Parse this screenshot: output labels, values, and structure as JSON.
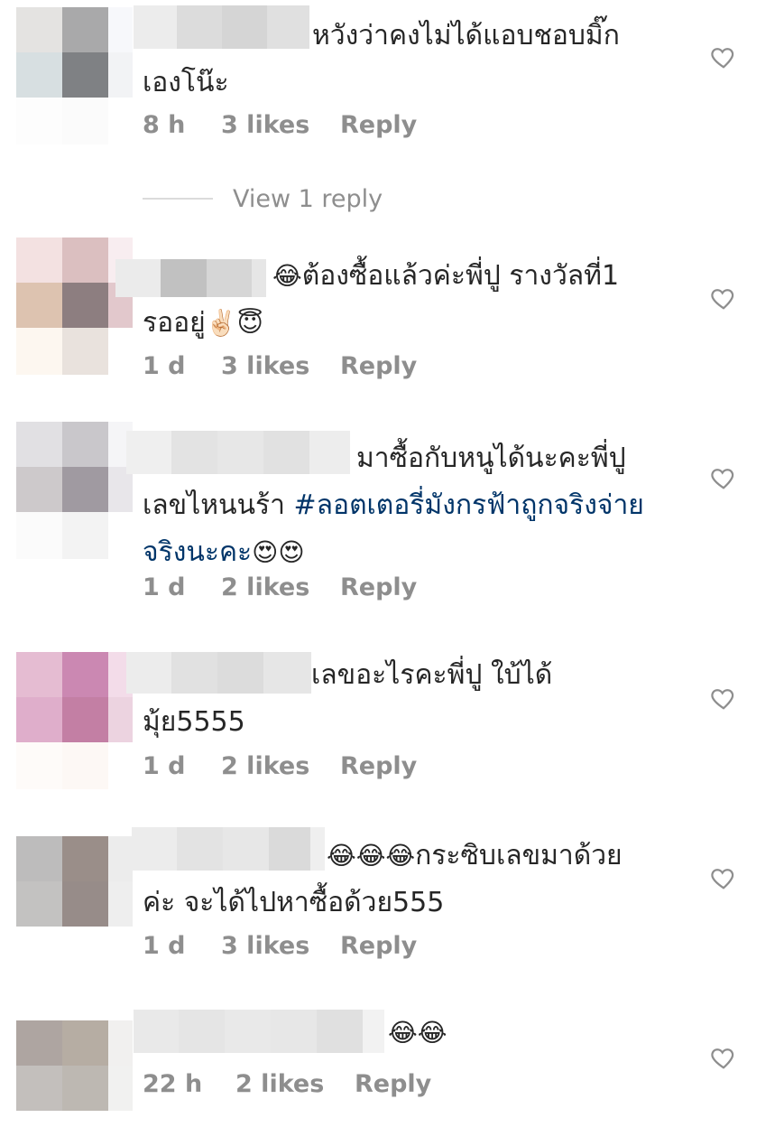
{
  "colors": {
    "meta": "#8e8e8e",
    "hashtag": "#003569",
    "text": "#262626"
  },
  "comments": [
    {
      "text_line1": "หวังว่าคงไม่ได้แอบชอบมิ๊ก",
      "text_line2": "เองโน๊ะ",
      "time": "8 h",
      "likes": "3 likes",
      "reply": "Reply",
      "view_replies": "View 1 reply"
    },
    {
      "emoji_lead": "😂",
      "text_line1": "ต้องซื้อแล้วค่ะพี่ปู รางวัลที่1",
      "text_line2": "รออยู่",
      "emoji_tail": "✌🏻😇",
      "time": "1 d",
      "likes": "3 likes",
      "reply": "Reply"
    },
    {
      "text_line1": "มาซื้อกับหนูได้นะคะพี่ปู",
      "text_line2_plain": "เลขไหนนร้า ",
      "hashtag_part1": "#ลอตเตอรี่มังกรฟ้าถูกจริงจ่าย",
      "hashtag_part2": "จริงนะคะ",
      "emoji_tail": "😍😍",
      "time": "1 d",
      "likes": "2 likes",
      "reply": "Reply"
    },
    {
      "text_line1": "เลขอะไรคะพี่ปู ใบ้ได้",
      "text_line2": "มุ้ย5555",
      "time": "1 d",
      "likes": "2 likes",
      "reply": "Reply"
    },
    {
      "emoji_lead": "😂😂😂",
      "text_line1": "กระซิบเลขมาด้วย",
      "text_line2": "ค่ะ จะได้ไปหาซื้อด้วย555",
      "time": "1 d",
      "likes": "3 likes",
      "reply": "Reply"
    },
    {
      "emoji_lead": "😂😂",
      "time": "22 h",
      "likes": "2 likes",
      "reply": "Reply"
    }
  ],
  "icons": {
    "like": "heart-outline-icon"
  }
}
